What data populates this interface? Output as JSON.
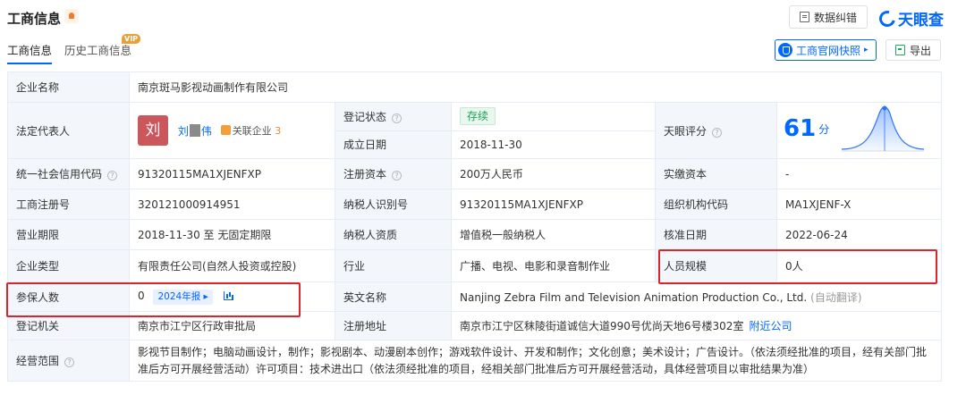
{
  "header": {
    "title": "工商信息",
    "correct_button": "数据纠错",
    "logo_text": "天眼查",
    "brand_color": "#0068ff"
  },
  "tabs": [
    {
      "label": "工商信息",
      "active": true
    },
    {
      "label": "历史工商信息",
      "badge": "VIP"
    }
  ],
  "actions": {
    "snapshot_button": "工商官网快照",
    "export_button": "导出"
  },
  "labels": {
    "company_name": "企业名称",
    "legal_rep": "法定代表人",
    "reg_status": "登记状态",
    "established": "成立日期",
    "score": "天眼评分",
    "credit_code": "统一社会信用代码",
    "reg_capital": "注册资本",
    "paid_capital": "实缴资本",
    "reg_number": "工商注册号",
    "taxpayer_id": "纳税人识别号",
    "org_code": "组织机构代码",
    "term": "营业期限",
    "taxpayer_qual": "纳税人资质",
    "approval_date": "核准日期",
    "company_type": "企业类型",
    "industry": "行业",
    "staff_size": "人员规模",
    "insured": "参保人数",
    "english_name": "英文名称",
    "authority": "登记机关",
    "address": "注册地址",
    "scope": "经营范围"
  },
  "values": {
    "company_name": "南京斑马影视动画制作有限公司",
    "legal_rep_avatar": "刘",
    "legal_rep_first": "刘",
    "legal_rep_last": "伟",
    "related_label": "关联企业",
    "related_count": "3",
    "reg_status": "存续",
    "established": "2018-11-30",
    "score": "61",
    "score_unit": "分",
    "credit_code": "91320115MA1XJENFXP",
    "reg_capital": "200万人民币",
    "paid_capital": "-",
    "reg_number": "320121000914951",
    "taxpayer_id": "91320115MA1XJENFXP",
    "org_code": "MA1XJENF-X",
    "term": "2018-11-30 至 无固定期限",
    "taxpayer_qual": "增值税一般纳税人",
    "approval_date": "2022-06-24",
    "company_type": "有限责任公司(自然人投资或控股)",
    "industry": "广播、电视、电影和录音制作业",
    "staff_size": "0人",
    "insured": "0",
    "insured_year": "2024年报",
    "english_name": "Nanjing Zebra Film and Television Animation Production Co., Ltd.",
    "auto_translate": "(自动翻译)",
    "authority": "南京市江宁区行政审批局",
    "address": "南京市江宁区秣陵街道诚信大道990号优尚天地6号楼302室",
    "nearby": "附近公司",
    "scope": "影视节目制作；电脑动画设计，制作；影视剧本、动漫剧本创作；游戏软件设计、开发和制作；文化创意；美术设计；广告设计。（依法须经批准的项目，经有关部门批准后方可开展经营活动）许可项目：技术进出口（依法须经批准的项目，经相关部门批准后方可开展经营活动，具体经营项目以审批结果为准）"
  },
  "colors": {
    "label_bg": "#f3f6fb",
    "border": "#e6ecf5",
    "highlight": "#d9252b",
    "status_green": "#1aa35a"
  }
}
